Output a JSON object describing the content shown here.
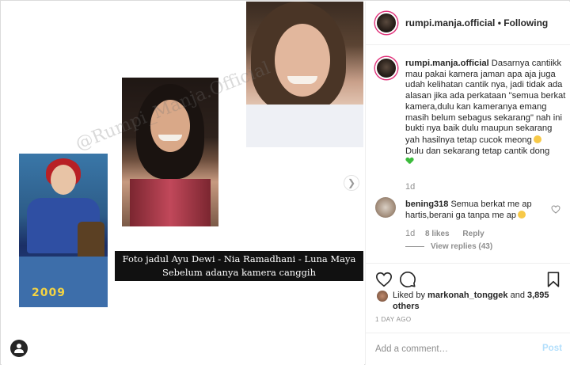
{
  "post_image": {
    "photos": [
      {
        "year": "2009"
      },
      {
        "year": ""
      },
      {
        "year": ""
      }
    ],
    "watermark": "@Rumpi_Manja.Official",
    "caption_line1": "Foto jadul  Ayu Dewi - Nia Ramadhani - Luna Maya",
    "caption_line2": "Sebelum adanya kamera canggih",
    "next_icon": "chevron-right-icon"
  },
  "header": {
    "username": "rumpi.manja.official",
    "separator": "•",
    "follow_status": "Following"
  },
  "caption": {
    "username": "rumpi.manja.official",
    "text": "Dasarnya cantiikk mau pakai kamera jaman apa aja juga udah kelihatan cantik nya, jadi tidak ada alasan jika ada perkataan \"semua berkat kamera,dulu kan kameranya emang masih belum sebagus sekarang\" nah ini bukti nya baik dulu maupun sekarang yah hasilnya tetap cucok meong",
    "text2": "Dulu dan sekarang tetap cantik dong",
    "time": "1d"
  },
  "comments": [
    {
      "username": "bening318",
      "text": "Semua berkat me ap hartis,berani ga tanpa me ap",
      "time": "1d",
      "likes": "8 likes",
      "reply_label": "Reply",
      "view_replies": "View replies (43)"
    }
  ],
  "likes": {
    "prefix": "Liked by",
    "user": "markonah_tonggek",
    "and": "and",
    "others": "3,895 others"
  },
  "post_time": "1 DAY AGO",
  "add_comment": {
    "placeholder": "Add a comment…",
    "post_label": "Post"
  },
  "icons": {
    "like": "heart-icon",
    "comment": "comment-bubble-icon",
    "save": "bookmark-icon",
    "tag": "user-tag-icon"
  },
  "colors": {
    "accent_link": "#b2dffc",
    "story_ring": "#e0337b",
    "caption_box": "#111111",
    "year_label": "#f5d442"
  }
}
